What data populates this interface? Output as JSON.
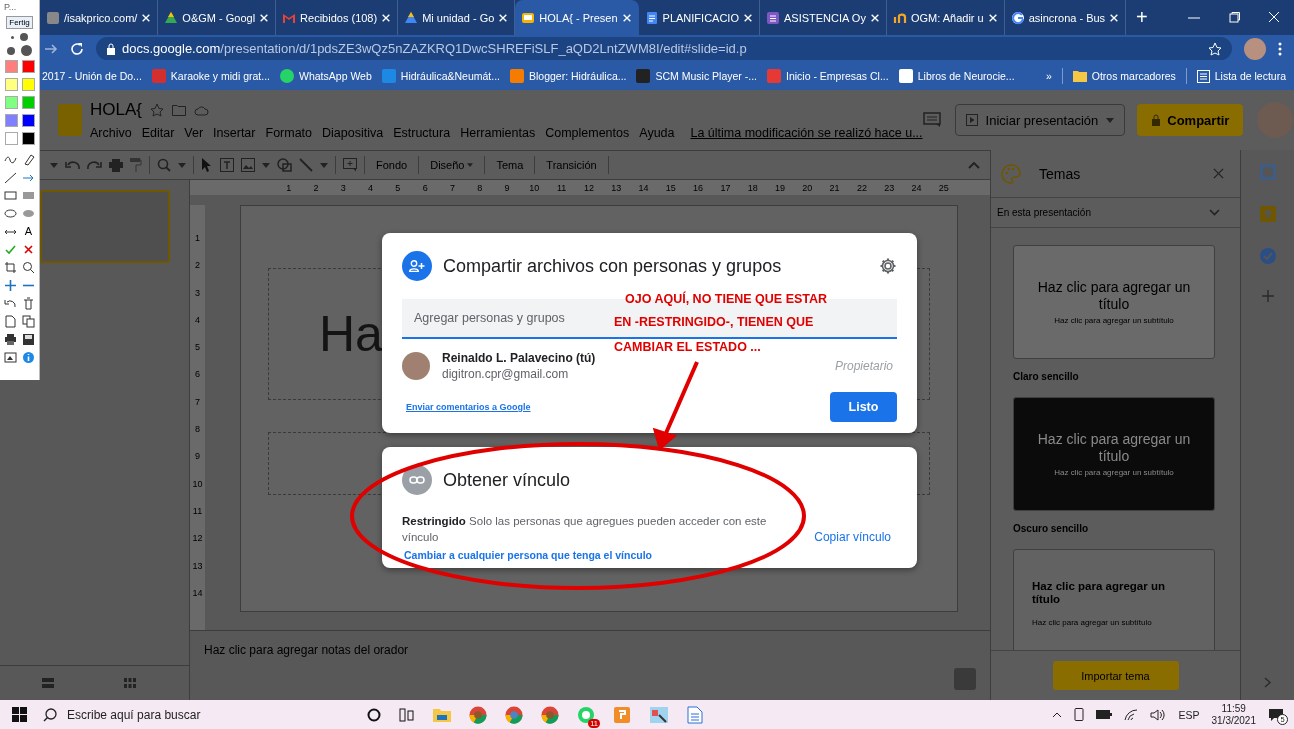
{
  "annotation_tool": {
    "title": "P...",
    "done_button": "Fertig",
    "text_tool": "A",
    "swatches": [
      {
        "color": "#ff7f7f"
      },
      {
        "color": "#ff0000"
      },
      {
        "color": "#ffff80"
      },
      {
        "color": "#ffff00"
      },
      {
        "color": "#80ff80"
      },
      {
        "color": "#00d000"
      },
      {
        "color": "#8080ff"
      },
      {
        "color": "#0000ff"
      },
      {
        "color": "#ffffff"
      },
      {
        "color": "#000000"
      }
    ]
  },
  "browser": {
    "tabs": [
      {
        "title": "/isakprico.com/",
        "selected": false
      },
      {
        "title": "O&GM - Googl",
        "selected": false
      },
      {
        "title": "Recibidos (108)",
        "selected": false
      },
      {
        "title": "Mi unidad - Go",
        "selected": false
      },
      {
        "title": "HOLA{ - Presen",
        "selected": true
      },
      {
        "title": "PLANIFICACIO",
        "selected": false
      },
      {
        "title": "ASISTENCIA Oy",
        "selected": false
      },
      {
        "title": "OGM: Añadir u",
        "selected": false
      },
      {
        "title": "asincrona - Bus",
        "selected": false
      }
    ],
    "new_tab": "+",
    "url_host": "docs.google.com",
    "url_path": "/presentation/d/1pdsZE3wQz5nZAZKRQ1DwcSHREFiSLF_aQD2LntZWM8I/edit#slide=id.p",
    "bookmarks": [
      "2017 - Unión de Do...",
      "Karaoke y midi grat...",
      "WhatsApp Web",
      "Hidráulica&Neumát...",
      "Blogger: Hidráulica...",
      "SCM Music Player -...",
      "Inicio - Empresas Cl...",
      "Libros de Neurocie..."
    ],
    "more_bookmarks": "»",
    "other_bookmarks": "Otros marcadores",
    "reading_list": "Lista de lectura"
  },
  "slides": {
    "title": "HOLA{",
    "menu": [
      "Archivo",
      "Editar",
      "Ver",
      "Insertar",
      "Formato",
      "Diapositiva",
      "Estructura",
      "Herramientas",
      "Complementos",
      "Ayuda"
    ],
    "last_edit": "La última modificación se realizó hace u...",
    "present_button": "Iniciar presentación",
    "share_button": "Compartir",
    "toolbar_buttons": [
      "Fondo",
      "Diseño",
      "Tema",
      "Transición"
    ],
    "ruler_h": [
      "1",
      "2",
      "3",
      "4",
      "5",
      "6",
      "7",
      "8",
      "9",
      "10",
      "11",
      "12",
      "13",
      "14",
      "15",
      "16",
      "17",
      "18",
      "19",
      "20",
      "21",
      "22",
      "23",
      "24",
      "25"
    ],
    "ruler_v": [
      "1",
      "2",
      "3",
      "4",
      "5",
      "6",
      "7",
      "8",
      "9",
      "10",
      "11",
      "12",
      "13",
      "14"
    ],
    "filmstrip": [
      {
        "selected": true
      }
    ],
    "slide_title": "Ha",
    "notes_placeholder": "Haz clic para agregar notas del orador"
  },
  "themes_panel": {
    "title": "Temas",
    "filter": "En esta presentación",
    "themes": [
      {
        "kind": "light",
        "title": "Haz clic para agregar un título",
        "subtitle": "Haz clic para agregar un subtítulo",
        "name": "Claro sencillo"
      },
      {
        "kind": "dark",
        "title": "Haz clic para agregar un título",
        "subtitle": "Haz clic para agregar un subtítulo",
        "name": "Oscuro sencillo"
      },
      {
        "kind": "streamline",
        "title": "Haz clic para agregar un título",
        "subtitle": "Haz clic para agregar un subtítulo"
      }
    ],
    "import_button": "Importar tema"
  },
  "share_dialog": {
    "title": "Compartir archivos con personas y grupos",
    "add_placeholder": "Agregar personas y grupos",
    "owner_name": "Reinaldo L. Palavecino (tú)",
    "owner_email": "digitron.cpr@gmail.com",
    "owner_role": "Propietario",
    "feedback_link": "Enviar comentarios a Google",
    "done_button": "Listo",
    "link_title": "Obtener vínculo",
    "link_text": "**Restringido** Solo las personas que agregues pueden acceder con este vínculo",
    "change_link": "Cambiar a cualquier persona que tenga el vínculo",
    "copy_link": "Copiar vínculo"
  },
  "annotation": {
    "lines": [
      "OJO AQUÍ, NO TIENE QUE ESTAR",
      "EN -RESTRINGIDO-, TIENEN QUE",
      "CAMBIAR EL ESTADO ..."
    ]
  },
  "taskbar": {
    "search_placeholder": "Escribe aquí para buscar",
    "whatsapp_badge": "11",
    "language": "ESP",
    "time": "11:59",
    "date": "31/3/2021",
    "notifications": "5"
  }
}
